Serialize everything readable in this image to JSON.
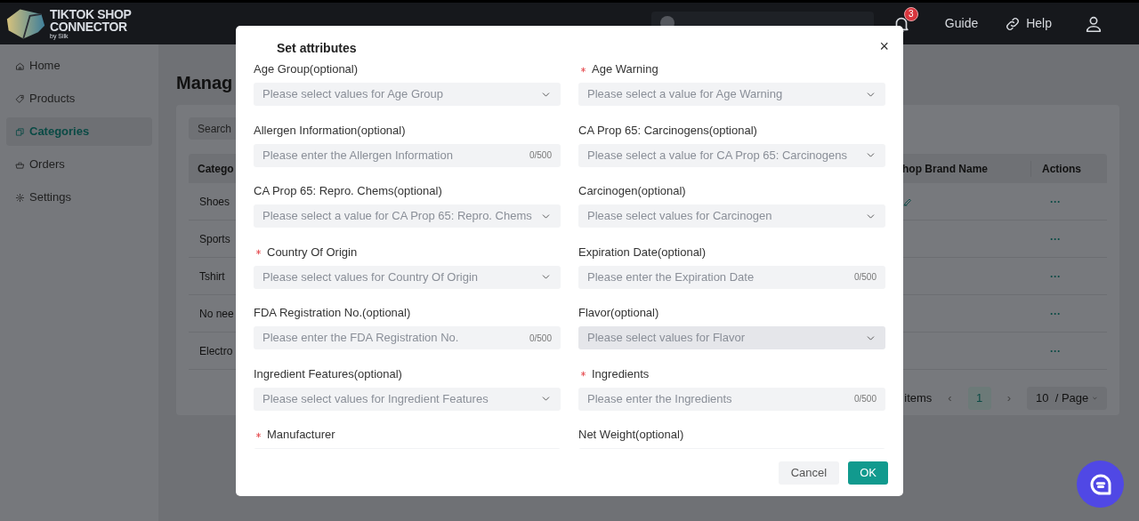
{
  "header": {
    "logo_line_1": "TIKTOK SHOP",
    "logo_line_2": "CONNECTOR",
    "logo_byline": "by Silk",
    "store": {
      "kind": "avatar"
    },
    "notifications": "3",
    "links": [
      {
        "kind": "guide",
        "label": "Guide"
      },
      {
        "kind": "help",
        "label": "Help"
      }
    ]
  },
  "sidebar": {
    "items": [
      {
        "kind": "home",
        "label": "Home",
        "selected": false
      },
      {
        "kind": "tag",
        "label": "Products",
        "selected": false
      },
      {
        "kind": "copy",
        "label": "Categories",
        "selected": true
      },
      {
        "kind": "basket",
        "label": "Orders",
        "selected": false
      },
      {
        "kind": "gear",
        "label": "Settings",
        "selected": false
      }
    ]
  },
  "main": {
    "title": "Manag",
    "search_placeholder": "Search",
    "table": {
      "columns": [
        "Catego",
        "hop Brand Name",
        "Actions"
      ],
      "rows": [
        {
          "category": "Shoes",
          "editable": true,
          "actions": "···"
        },
        {
          "category": "Sports",
          "editable": false,
          "actions": "···"
        },
        {
          "category": "Tshirt",
          "editable": false,
          "actions": "···"
        },
        {
          "category": "No nee",
          "editable": false,
          "actions": "···"
        },
        {
          "category": "Electro",
          "editable": false,
          "actions": "···"
        }
      ]
    },
    "pagination": {
      "total": "items",
      "prev": "‹",
      "pages": [
        {
          "label": "1",
          "selected": true
        }
      ],
      "next": "›",
      "page_size": "10  / Page"
    }
  },
  "dialog": {
    "title": "Set attributes",
    "close": "×",
    "fields": [
      {
        "label": "Age Group(optional)",
        "required": false,
        "kind": "select",
        "placeholder": "Please select values for Age Group",
        "hovered": false
      },
      {
        "label": "Age Warning",
        "required": true,
        "kind": "select",
        "placeholder": "Please select a value for Age Warning",
        "hovered": false
      },
      {
        "label": "Allergen Information(optional)",
        "required": false,
        "kind": "text",
        "placeholder": "Please enter the Allergen Information",
        "counter": "0/500",
        "hovered": false
      },
      {
        "label": "CA Prop 65: Carcinogens(optional)",
        "required": false,
        "kind": "select",
        "placeholder": "Please select a value for CA Prop 65: Carcinogens",
        "hovered": false
      },
      {
        "label": "CA Prop 65: Repro. Chems(optional)",
        "required": false,
        "kind": "select",
        "placeholder": "Please select a value for CA Prop 65: Repro. Chems",
        "hovered": false
      },
      {
        "label": "Carcinogen(optional)",
        "required": false,
        "kind": "select",
        "placeholder": "Please select values for Carcinogen",
        "hovered": false
      },
      {
        "label": "Country Of Origin",
        "required": true,
        "kind": "select",
        "placeholder": "Please select values for Country Of Origin",
        "hovered": false
      },
      {
        "label": "Expiration Date(optional)",
        "required": false,
        "kind": "text",
        "placeholder": "Please enter the Expiration Date",
        "counter": "0/500",
        "hovered": false
      },
      {
        "label": "FDA Registration No.(optional)",
        "required": false,
        "kind": "text",
        "placeholder": "Please enter the FDA Registration No.",
        "counter": "0/500",
        "hovered": false
      },
      {
        "label": "Flavor(optional)",
        "required": false,
        "kind": "select",
        "placeholder": "Please select values for Flavor",
        "hovered": true
      },
      {
        "label": "Ingredient Features(optional)",
        "required": false,
        "kind": "select",
        "placeholder": "Please select values for Ingredient Features",
        "hovered": false
      },
      {
        "label": "Ingredients",
        "required": true,
        "kind": "text",
        "placeholder": "Please enter the Ingredients",
        "counter": "0/500",
        "hovered": false
      },
      {
        "label": "Manufacturer",
        "required": true,
        "kind": "partial",
        "hovered": false
      },
      {
        "label": "Net Weight(optional)",
        "required": false,
        "kind": "partial",
        "hovered": false
      }
    ],
    "buttons": [
      {
        "kind": "secondary",
        "label": "Cancel"
      },
      {
        "kind": "primary",
        "label": "OK"
      }
    ]
  }
}
